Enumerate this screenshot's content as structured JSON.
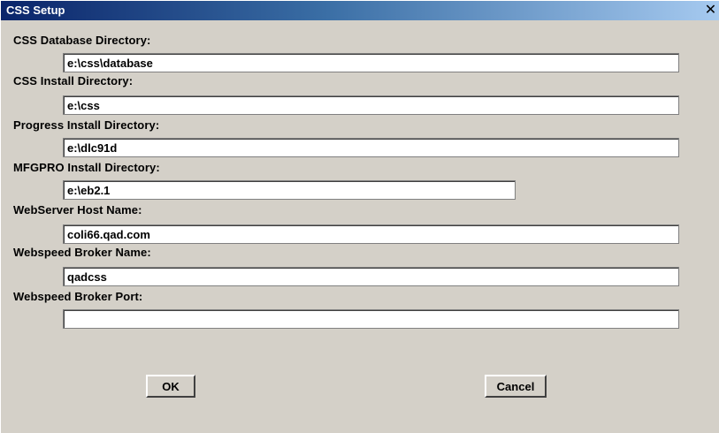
{
  "window": {
    "title": "CSS Setup",
    "close_glyph": "✕",
    "close_icon": "close-icon",
    "title_gradient": [
      "#0a246a",
      "#a6caf0"
    ],
    "face_color": "#d4d0c8"
  },
  "fields": {
    "database_dir": {
      "label": "CSS Database Directory:",
      "value": "e:\\css\\database"
    },
    "install_dir": {
      "label": "CSS Install Directory:",
      "value": "e:\\css"
    },
    "progress_dir": {
      "label": "Progress Install Directory:",
      "value": "e:\\dlc91d"
    },
    "mfgpro_dir": {
      "label": "MFGPRO Install Directory:",
      "value": "e:\\eb2.1"
    },
    "webserver_host": {
      "label": "WebServer Host Name:",
      "value": "coli66.qad.com"
    },
    "broker_name": {
      "label": "Webspeed Broker Name:",
      "value": "qadcss"
    },
    "broker_port": {
      "label": "Webspeed Broker Port:",
      "value": ""
    }
  },
  "buttons": {
    "ok_label": "OK",
    "cancel_label": "Cancel"
  }
}
